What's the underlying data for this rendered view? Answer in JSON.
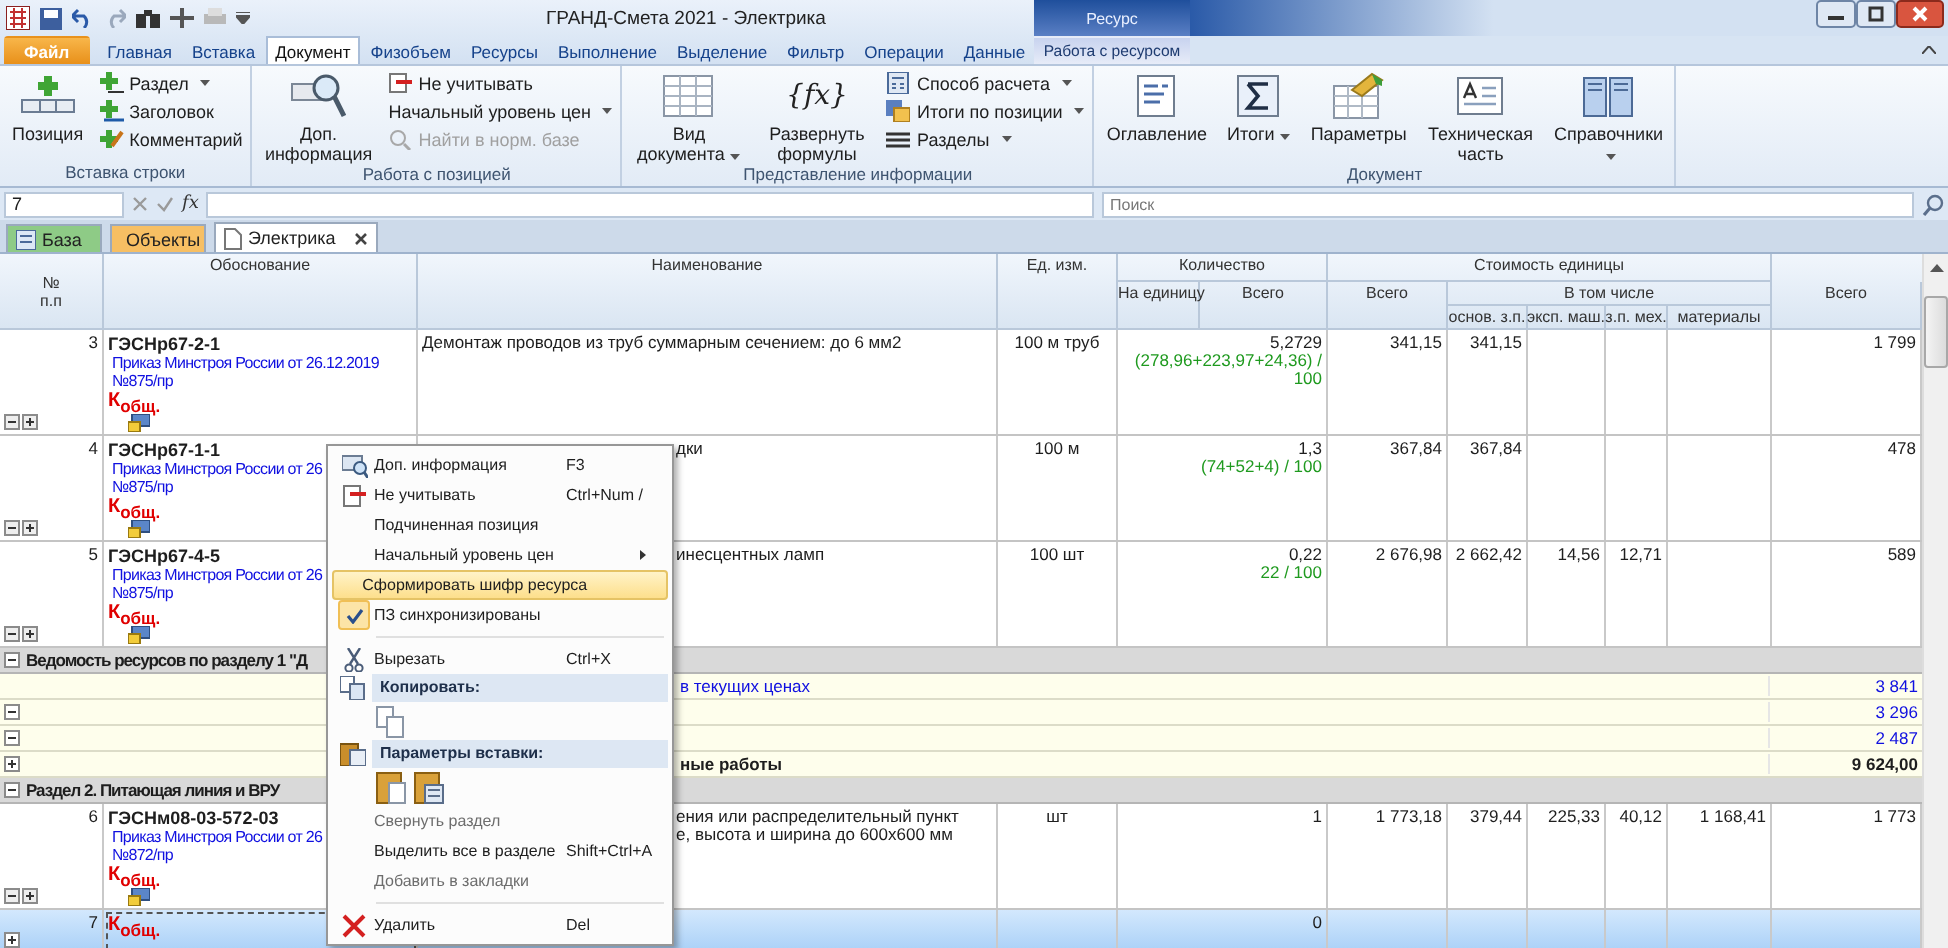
{
  "window": {
    "title": "ГРАНД-Смета 2021 - Электрика",
    "context_group": "Ресурс"
  },
  "ribbon_tabs": [
    {
      "label": "Файл",
      "kind": "file",
      "selected": false
    },
    {
      "label": "Главная",
      "kind": "tab",
      "selected": false
    },
    {
      "label": "Вставка",
      "kind": "tab",
      "selected": false
    },
    {
      "label": "Документ",
      "kind": "tab",
      "selected": true
    },
    {
      "label": "Физобъем",
      "kind": "tab",
      "selected": false
    },
    {
      "label": "Ресурсы",
      "kind": "tab",
      "selected": false
    },
    {
      "label": "Выполнение",
      "kind": "tab",
      "selected": false
    },
    {
      "label": "Выделение",
      "kind": "tab",
      "selected": false
    },
    {
      "label": "Фильтр",
      "kind": "tab",
      "selected": false
    },
    {
      "label": "Операции",
      "kind": "tab",
      "selected": false
    },
    {
      "label": "Данные",
      "kind": "tab",
      "selected": false
    },
    {
      "label": "Работа с ресурсом",
      "kind": "context",
      "selected": false
    }
  ],
  "ribbon_groups": [
    {
      "title": "Вставка строки",
      "columns": [
        {
          "kind": "large",
          "label": "Позиция",
          "dropdown": false,
          "disabled": false
        },
        {
          "kind": "stack",
          "items": [
            {
              "label": "Раздел",
              "dropdown": true,
              "disabled": false
            },
            {
              "label": "Заголовок",
              "dropdown": false,
              "disabled": false
            },
            {
              "label": "Комментарий",
              "dropdown": false,
              "disabled": false
            }
          ]
        }
      ]
    },
    {
      "title": "Работа с позицией",
      "columns": [
        {
          "kind": "large",
          "label": "Доп. информация",
          "dropdown": false,
          "disabled": false
        },
        {
          "kind": "stack",
          "items": [
            {
              "label": "Не учитывать",
              "dropdown": false,
              "disabled": false
            },
            {
              "label": "Начальный уровень цен",
              "dropdown": true,
              "disabled": false
            },
            {
              "label": "Найти в норм. базе",
              "dropdown": false,
              "disabled": true
            }
          ]
        }
      ]
    },
    {
      "title": "Представление информации",
      "columns": [
        {
          "kind": "large",
          "label": "Вид документа",
          "dropdown": true,
          "disabled": false
        },
        {
          "kind": "large",
          "label": "Развернуть формулы",
          "glyph": "{fx}",
          "dropdown": false,
          "disabled": false
        },
        {
          "kind": "stack",
          "items": [
            {
              "label": "Способ расчета",
              "dropdown": true,
              "disabled": false
            },
            {
              "label": "Итоги по позиции",
              "dropdown": true,
              "disabled": false
            },
            {
              "label": "Разделы",
              "dropdown": true,
              "disabled": false
            }
          ]
        }
      ]
    },
    {
      "title": "Документ",
      "columns": [
        {
          "kind": "large",
          "label": "Оглавление",
          "dropdown": false,
          "disabled": false
        },
        {
          "kind": "large",
          "label": "Итоги",
          "dropdown": true,
          "disabled": false
        },
        {
          "kind": "large",
          "label": "Параметры",
          "dropdown": false,
          "disabled": false
        },
        {
          "kind": "large",
          "label": "Техническая часть",
          "dropdown": false,
          "disabled": false
        },
        {
          "kind": "large",
          "label": "Справочники",
          "dropdown": true,
          "disabled": false
        }
      ]
    }
  ],
  "formula_bar": {
    "cell": "7",
    "function_label": "fx",
    "search_placeholder": "Поиск"
  },
  "document_tabs": [
    {
      "label": "База",
      "kind": "base",
      "selected": false
    },
    {
      "label": "Объекты",
      "kind": "objects",
      "selected": false
    },
    {
      "label": "Электрика",
      "kind": "document",
      "selected": true
    }
  ],
  "table": {
    "columns": {
      "number": [
        "№",
        "п.п"
      ],
      "justification": "Обоснование",
      "name": "Наименование",
      "unit": "Ед. изм.",
      "quantity": {
        "title": "Количество",
        "per_unit": "На единицу",
        "total": "Всего"
      },
      "unit_cost": {
        "title": "Стоимость единицы",
        "total": "Всего",
        "including": "В том числе",
        "parts": [
          "основ. з.п.",
          "эксп. маш.",
          "з.п. мех.",
          "материалы"
        ]
      },
      "total_cost": "Всего"
    },
    "rows": [
      {
        "kind": "position",
        "selected": false,
        "number": "3",
        "code": "ГЭСНр67-2-1",
        "source": [
          "Приказ Минстроя России от 26.12.2019",
          "№875/пр"
        ],
        "coefficient": "К$_{общ.}$",
        "name": [
          "Демонтаж проводов из труб суммарным сечением: до 6 мм2"
        ],
        "covered": false,
        "unit": "100 м труб",
        "quantity": "5,2729",
        "formula": [
          "(278,96+223,97+24,36) /",
          "100"
        ],
        "cost": "341,15",
        "parts": [
          "341,15"
        ],
        "total": "1 799"
      },
      {
        "kind": "position",
        "selected": false,
        "number": "4",
        "code": "ГЭСНр67-1-1",
        "source": [
          "Приказ Минстроя России от 26",
          "№875/пр"
        ],
        "coefficient": "К$_{общ.}$",
        "name": [
          "дки"
        ],
        "covered": true,
        "unit": "100 м",
        "quantity": "1,3",
        "formula": [
          "(74+52+4) / 100"
        ],
        "cost": "367,84",
        "parts": [
          "367,84"
        ],
        "total": "478"
      },
      {
        "kind": "position",
        "selected": false,
        "number": "5",
        "code": "ГЭСНр67-4-5",
        "source": [
          "Приказ Минстроя России от 26",
          "№875/пр"
        ],
        "coefficient": "К$_{общ.}$",
        "name": [
          "инесцентных ламп"
        ],
        "covered": true,
        "unit": "100 шт",
        "quantity": "0,22",
        "formula": [
          "22 / 100"
        ],
        "cost": "2 676,98",
        "parts": [
          "2 662,42",
          "14,56",
          "12,71"
        ],
        "total": "589"
      },
      {
        "kind": "section",
        "selected": false,
        "expanded": true,
        "title": "Ведомость ресурсов по разделу 1 \"Д"
      },
      {
        "kind": "summary",
        "selected": false,
        "label": "в текущих ценах",
        "covered": true,
        "bold": false,
        "total": "3 841"
      },
      {
        "kind": "summary",
        "selected": false,
        "expanded": true,
        "bold": false,
        "total": "3 296"
      },
      {
        "kind": "summary",
        "selected": false,
        "expanded": true,
        "bold": false,
        "total": "2 487"
      },
      {
        "kind": "summary",
        "selected": false,
        "expanded": false,
        "label": "ные работы",
        "covered": true,
        "bold": true,
        "total": "9 624,00"
      },
      {
        "kind": "section",
        "selected": false,
        "expanded": true,
        "title": "Раздел 2. Питающая линия и ВРУ"
      },
      {
        "kind": "position",
        "selected": false,
        "number": "6",
        "code": "ГЭСНм08-03-572-03",
        "source": [
          "Приказ Минстроя России от 26",
          "№872/пр"
        ],
        "coefficient": "К$_{общ.}$",
        "name": [
          "ения или распределительный пункт",
          "е, высота и ширина до 600х600 мм"
        ],
        "covered": true,
        "unit": "шт",
        "quantity": "1",
        "cost": "1 773,18",
        "parts": [
          "379,44",
          "225,33",
          "40,12",
          "1 168,41"
        ],
        "total": "1 773"
      },
      {
        "kind": "new",
        "selected": true,
        "number": "7",
        "coefficient": "К$_{общ.}$",
        "quantity": "0"
      }
    ]
  },
  "context_menu": [
    {
      "kind": "command",
      "label": "Доп. информация",
      "shortcut": "F3",
      "selected": false,
      "disabled": false
    },
    {
      "kind": "command",
      "label": "Не учитывать",
      "shortcut": "Ctrl+Num /",
      "selected": false,
      "disabled": false
    },
    {
      "kind": "command",
      "label": "Подчиненная позиция",
      "selected": false,
      "disabled": false
    },
    {
      "kind": "submenu",
      "label": "Начальный уровень цен",
      "selected": false,
      "disabled": false
    },
    {
      "kind": "command",
      "label": "Сформировать шифр ресурса",
      "selected": true,
      "disabled": false
    },
    {
      "kind": "toggle",
      "label": "ПЗ синхронизированы",
      "checked": true,
      "selected": false,
      "disabled": false
    },
    {
      "kind": "separator"
    },
    {
      "kind": "command",
      "label": "Вырезать",
      "shortcut": "Ctrl+X",
      "selected": false,
      "disabled": false
    },
    {
      "kind": "heading",
      "label": "Копировать:"
    },
    {
      "kind": "copy_options"
    },
    {
      "kind": "heading",
      "label": "Параметры вставки:"
    },
    {
      "kind": "paste_options"
    },
    {
      "kind": "command",
      "label": "Свернуть раздел",
      "selected": false,
      "disabled": true
    },
    {
      "kind": "command",
      "label": "Выделить все в разделе",
      "shortcut": "Shift+Ctrl+A",
      "selected": false,
      "disabled": false
    },
    {
      "kind": "command",
      "label": "Добавить в закладки",
      "selected": false,
      "disabled": true
    },
    {
      "kind": "separator"
    },
    {
      "kind": "command",
      "label": "Удалить",
      "shortcut": "Del",
      "selected": false,
      "disabled": false
    }
  ]
}
